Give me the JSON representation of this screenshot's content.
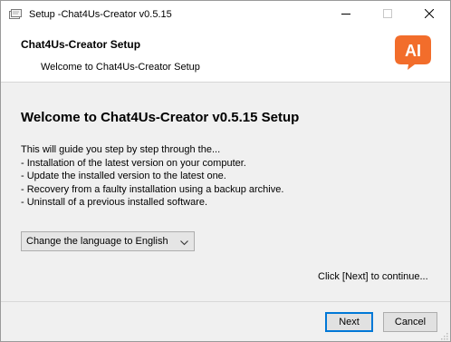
{
  "window": {
    "title": "Setup -Chat4Us-Creator v0.5.15",
    "app_icon": "installer-icon",
    "controls": [
      "minimize-icon",
      "maximize-icon",
      "close-icon"
    ]
  },
  "header": {
    "title": "Chat4Us-Creator Setup",
    "subtitle": "Welcome to Chat4Us-Creator Setup",
    "logo_text": "AI",
    "logo_color": "#f26d2b"
  },
  "main": {
    "heading": "Welcome to Chat4Us-Creator v0.5.15 Setup",
    "description": [
      "This will guide you step by step through the...",
      "- Installation of the latest version on your computer.",
      "- Update the installed version to the latest one.",
      "- Recovery from a faulty installation using a backup archive.",
      "- Uninstall of a previous installed software."
    ],
    "language_select": {
      "value": "Change the language to English",
      "icon": "chevron-down-icon"
    },
    "continue_hint": "Click [Next] to continue..."
  },
  "footer": {
    "next_label": "Next",
    "cancel_label": "Cancel",
    "focus_color": "#0078d7"
  }
}
